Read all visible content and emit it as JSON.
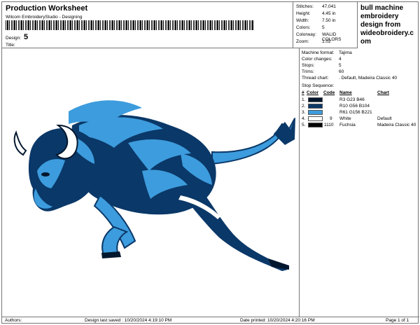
{
  "header": {
    "title": "Production Worksheet",
    "software": "Wilcom EmbroideryStudio - Designing",
    "design_label": "Design:",
    "design_value": "5",
    "title_label": "Title:",
    "title_value": ""
  },
  "stats": [
    {
      "label": "Stitches:",
      "value": "47,041"
    },
    {
      "label": "Height:",
      "value": "4.45 in"
    },
    {
      "label": "Width:",
      "value": "7.50 in"
    },
    {
      "label": "Colors:",
      "value": "5"
    },
    {
      "label": "Colorway:",
      "value": "WALID COLORS"
    },
    {
      "label": "Zoom:",
      "value": "1.02"
    }
  ],
  "promo": {
    "lines": [
      "bull machine",
      "embroidery",
      "design from",
      "wideobroidery.c",
      "om"
    ]
  },
  "machine_info": [
    {
      "label": "Machine format:",
      "value": "Tajima"
    },
    {
      "label": "Color changes:",
      "value": "4"
    },
    {
      "label": "Stops:",
      "value": "5"
    },
    {
      "label": "Trims:",
      "value": "60"
    },
    {
      "label": "Thread chart:",
      "value": ". Default, Madeira Classic 40"
    }
  ],
  "stop_sequence": {
    "title": "Stop Sequence:",
    "headers": {
      "num": "#",
      "color": "Color",
      "code": "Code",
      "name": "Name",
      "chart": "Chart"
    },
    "rows": [
      {
        "num": "1.",
        "color": "#03172e",
        "code": "",
        "name": "R3 G23 B46",
        "chart": ""
      },
      {
        "num": "2.",
        "color": "#0a3868",
        "code": "",
        "name": "R10 G56 B104",
        "chart": ""
      },
      {
        "num": "3.",
        "color": "#3d9cdd",
        "code": "",
        "name": "R61 G156 B221",
        "chart": ""
      },
      {
        "num": "4.",
        "color": "#ffffff",
        "code": "9",
        "name": "White",
        "chart": "Default"
      },
      {
        "num": "5.",
        "color": "#050505",
        "code": "1110",
        "name": "Fuchsia",
        "chart": "Madeira Classic 40"
      }
    ]
  },
  "footer": {
    "authors": "Authors:",
    "saved": "Design last saved : 10/20/2024 4:19:10 PM",
    "printed": "Date printed: 10/20/2024 4:20:16 PM",
    "page": "Page 1 of 1"
  },
  "colors": {
    "navy": "#0a3868",
    "blue": "#3d9cdd",
    "dark": "#03172e",
    "white": "#ffffff"
  }
}
